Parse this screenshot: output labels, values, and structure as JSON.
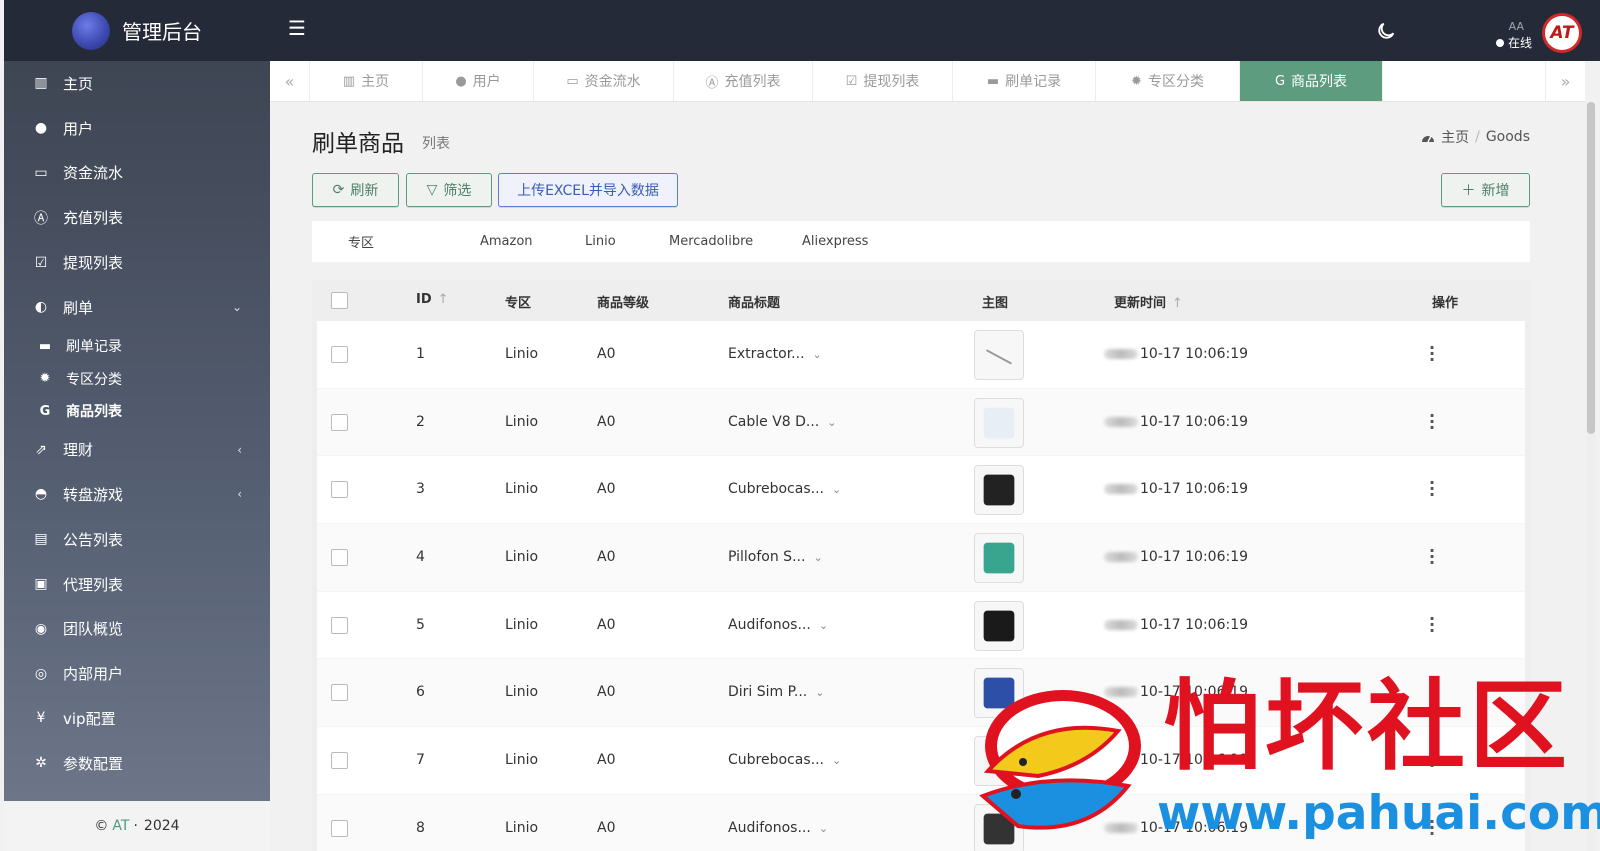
{
  "brand": {
    "title": "管理后台"
  },
  "header": {
    "status": "在线",
    "user": "AA",
    "avatar_text": "AT"
  },
  "sidebar": {
    "items": [
      {
        "label": "主页",
        "icon": "bar-chart-icon"
      },
      {
        "label": "用户",
        "icon": "user-icon"
      },
      {
        "label": "资金流水",
        "icon": "money-icon"
      },
      {
        "label": "充值列表",
        "icon": "letter-a-icon"
      },
      {
        "label": "提现列表",
        "icon": "check-square-icon"
      },
      {
        "label": "刷单",
        "icon": "half-circle-icon",
        "expanded": true
      }
    ],
    "sub_items": [
      {
        "label": "刷单记录",
        "icon": "keyboard-icon"
      },
      {
        "label": "专区分类",
        "icon": "gear-icon"
      },
      {
        "label": "商品列表",
        "icon": "google-icon",
        "active": true
      }
    ],
    "items_after": [
      {
        "label": "理财",
        "icon": "chart-icon",
        "has_children": true
      },
      {
        "label": "转盘游戏",
        "icon": "gamepad-icon",
        "has_children": true
      },
      {
        "label": "公告列表",
        "icon": "document-icon"
      },
      {
        "label": "代理列表",
        "icon": "contact-icon"
      },
      {
        "label": "团队概览",
        "icon": "users-icon"
      },
      {
        "label": "内部用户",
        "icon": "user-circle-icon"
      },
      {
        "label": "vip配置",
        "icon": "yen-icon"
      },
      {
        "label": "参数配置",
        "icon": "gears-icon"
      }
    ],
    "footer": {
      "copyright": "©",
      "brand": "AT",
      "dot": "·",
      "year": "2024"
    }
  },
  "tabs": [
    {
      "label": "主页",
      "icon": "bar-chart-icon"
    },
    {
      "label": "用户",
      "icon": "user-icon"
    },
    {
      "label": "资金流水",
      "icon": "money-icon"
    },
    {
      "label": "充值列表",
      "icon": "letter-a-icon"
    },
    {
      "label": "提现列表",
      "icon": "check-square-icon"
    },
    {
      "label": "刷单记录",
      "icon": "keyboard-icon"
    },
    {
      "label": "专区分类",
      "icon": "gear-icon"
    },
    {
      "label": "商品列表",
      "icon": "google-icon",
      "active": true
    }
  ],
  "page": {
    "title": "刷单商品",
    "subtitle": "列表",
    "breadcrumb": {
      "home": "主页",
      "separator": "/",
      "current": "Goods"
    }
  },
  "toolbar": {
    "refresh": "刷新",
    "filter": "筛选",
    "upload": "上传EXCEL并导入数据",
    "add": "新增"
  },
  "zone_filter": {
    "label": "专区",
    "options": [
      "Amazon",
      "Linio",
      "Mercadolibre",
      "Aliexpress"
    ]
  },
  "table": {
    "headers": {
      "id": "ID",
      "zone": "专区",
      "level": "商品等级",
      "title": "商品标题",
      "image": "主图",
      "updated": "更新时间",
      "actions": "操作"
    },
    "rows": [
      {
        "id": "1",
        "zone": "Linio",
        "level": "A0",
        "title": "Extractor...",
        "updated": "10-17 10:06:19"
      },
      {
        "id": "2",
        "zone": "Linio",
        "level": "A0",
        "title": "Cable V8 D...",
        "updated": "10-17 10:06:19"
      },
      {
        "id": "3",
        "zone": "Linio",
        "level": "A0",
        "title": "Cubrebocas...",
        "updated": "10-17 10:06:19"
      },
      {
        "id": "4",
        "zone": "Linio",
        "level": "A0",
        "title": "Pillofon S...",
        "updated": "10-17 10:06:19"
      },
      {
        "id": "5",
        "zone": "Linio",
        "level": "A0",
        "title": "Audifonos...",
        "updated": "10-17 10:06:19"
      },
      {
        "id": "6",
        "zone": "Linio",
        "level": "A0",
        "title": "Diri Sim P...",
        "updated": "10-17 10:06:19"
      },
      {
        "id": "7",
        "zone": "Linio",
        "level": "A0",
        "title": "Cubrebocas...",
        "updated": "10-17 10:06:19"
      },
      {
        "id": "8",
        "zone": "Linio",
        "level": "A0",
        "title": "Audifonos...",
        "updated": "10-17 10:06:19"
      }
    ]
  },
  "watermark": {
    "text": "怕坏社区",
    "url": "www.pahuai.com"
  },
  "colors": {
    "header": "#242a37",
    "accent": "#5d9c7e",
    "upload": "#5b7fd6",
    "watermark_red": "#e0121f",
    "watermark_blue": "#1b8fe0"
  }
}
